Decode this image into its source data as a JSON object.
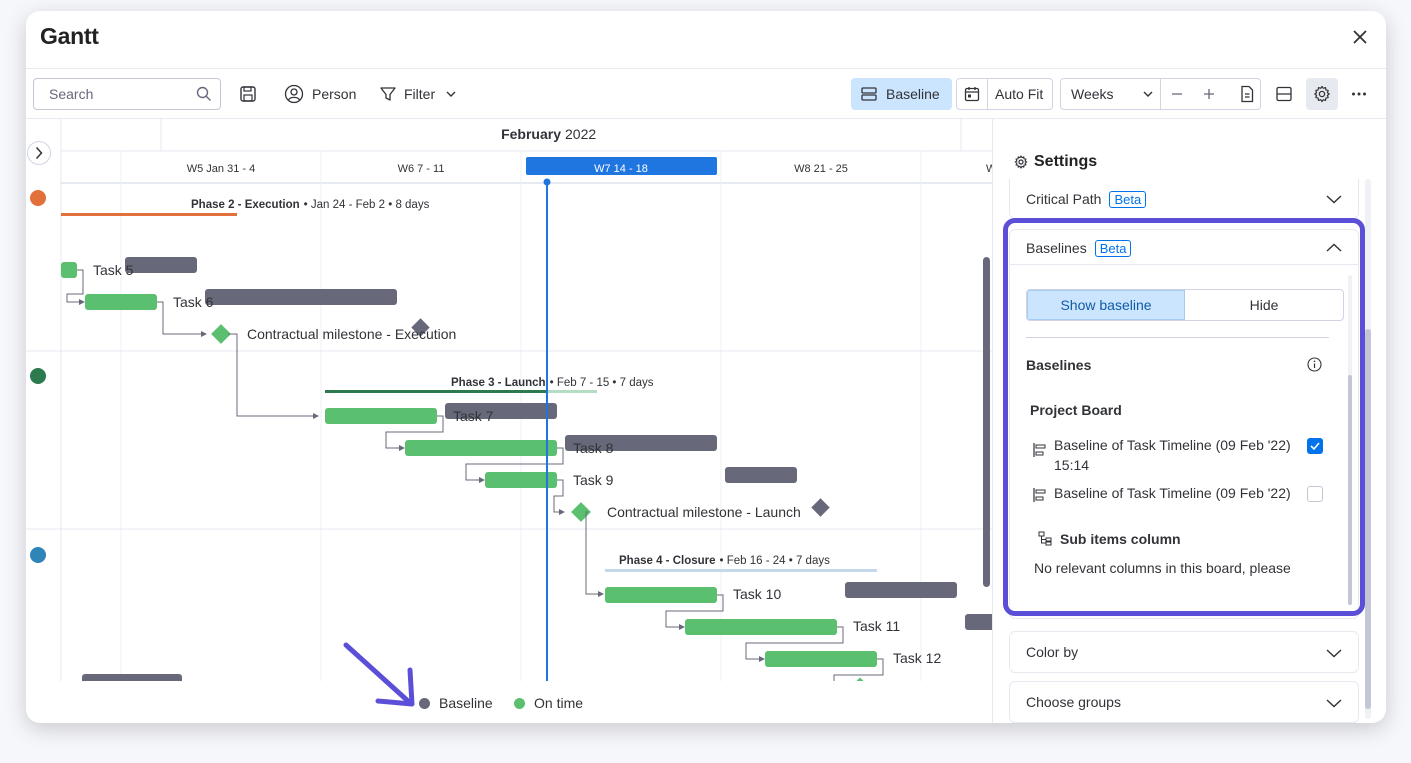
{
  "window": {
    "title": "Gantt"
  },
  "toolbar": {
    "search_placeholder": "Search",
    "person_label": "Person",
    "filter_label": "Filter",
    "baseline_label": "Baseline",
    "autofit_label": "Auto Fit",
    "zoom_value": "Weeks"
  },
  "timeline": {
    "month": "February",
    "year": "2022",
    "weeks": [
      {
        "label": "W5 Jan 31 - 4"
      },
      {
        "label": "W6 7 - 11"
      },
      {
        "label": "W7 14 - 18",
        "current": true
      },
      {
        "label": "W8 21 - 25"
      },
      {
        "label": "W"
      }
    ]
  },
  "phases": [
    {
      "name": "Phase 2 - Execution",
      "meta": "• Jan 24 - Feb 2 • 8 days",
      "color": "#e2703a"
    },
    {
      "name": "Phase 3 - Launch",
      "meta": "• Feb 7 - 15 • 7 days",
      "color": "#2d7a4f"
    },
    {
      "name": "Phase 4 - Closure",
      "meta": "• Feb 16 - 24 • 7 days",
      "color": "#2f84b8"
    }
  ],
  "tasks": [
    {
      "name": "Task 5"
    },
    {
      "name": "Task 6"
    },
    {
      "name": "Contractual milestone - Execution"
    },
    {
      "name": "Task 7"
    },
    {
      "name": "Task 8"
    },
    {
      "name": "Task 9"
    },
    {
      "name": "Contractual milestone - Launch"
    },
    {
      "name": "Task 10"
    },
    {
      "name": "Task 11"
    },
    {
      "name": "Task 12"
    }
  ],
  "legend": {
    "baseline_label": "Baseline",
    "ontime_label": "On time",
    "baseline_color": "#676879",
    "ontime_color": "#5ac06f"
  },
  "settings": {
    "title": "Settings",
    "critical_path_label": "Critical Path",
    "beta_label": "Beta",
    "baselines_section_label": "Baselines",
    "show_baseline_label": "Show baseline",
    "hide_label": "Hide",
    "baselines_heading": "Baselines",
    "board_name": "Project Board",
    "baseline_items": [
      {
        "label_line1": "Baseline of Task Timeline (09 Feb '22)",
        "label_line2": "15:14",
        "checked": true
      },
      {
        "label_line1": "Baseline of Task Timeline (09 Feb '22)",
        "label_line2": "",
        "checked": false
      }
    ],
    "sub_items_label": "Sub items column",
    "sub_items_note": "No relevant columns in this board, please",
    "color_by_label": "Color by",
    "choose_groups_label": "Choose groups"
  },
  "colors": {
    "accent": "#0073ea",
    "highlight": "#5b4fd8",
    "bar_green": "#5ac06f",
    "bar_grey": "#676879"
  }
}
